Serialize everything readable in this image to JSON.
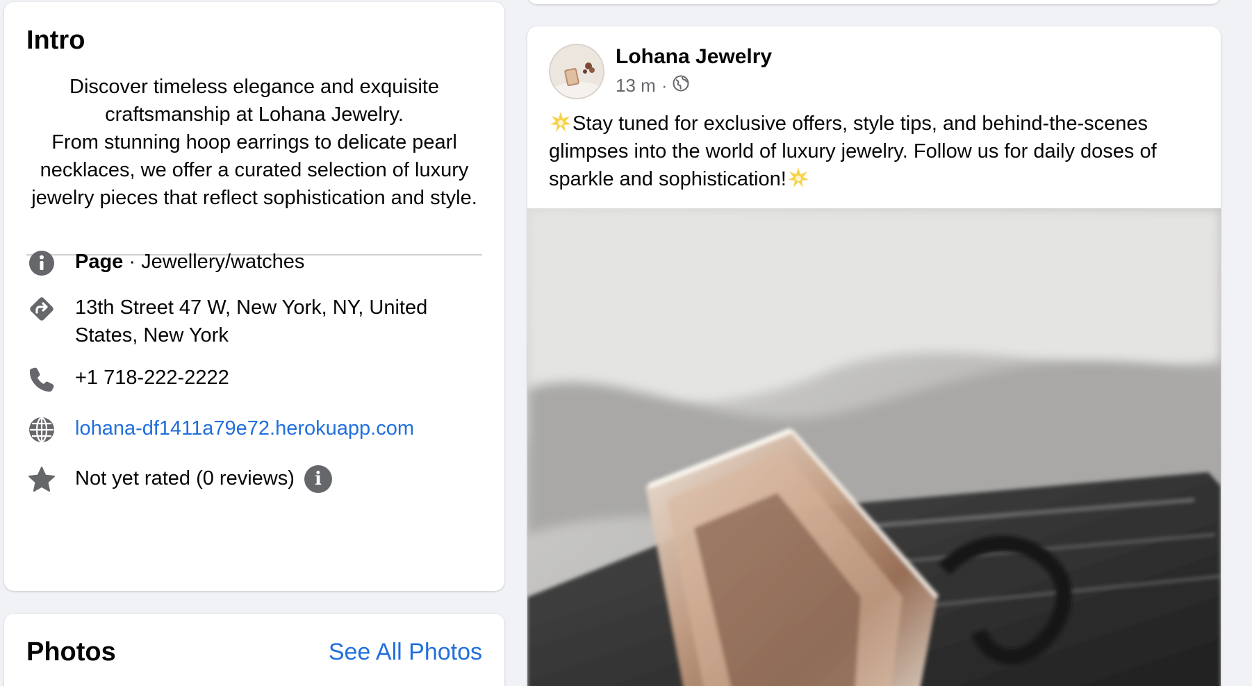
{
  "intro": {
    "title": "Intro",
    "bio": "Discover timeless elegance and exquisite craftsmanship at Lohana Jewelry.\nFrom stunning hoop earrings to delicate pearl necklaces, we offer a curated selection of luxury jewelry pieces that reflect sophistication and style.",
    "page_label": "Page",
    "category": " · Jewellery/watches",
    "address": "13th Street 47 W, New York, NY, United States, New York",
    "phone": "+1 718-222-2222",
    "website": "lohana-df1411a79e72.herokuapp.com",
    "rating": "Not yet rated (0 reviews)",
    "icons": [
      "info-icon",
      "directions-icon",
      "phone-icon",
      "globe-icon",
      "star-icon",
      "info-icon"
    ]
  },
  "photos": {
    "title": "Photos",
    "see_all": "See All Photos"
  },
  "post": {
    "author": "Lohana Jewelry",
    "time": "13 m",
    "separator": "·",
    "audience_icon": "globe-icon",
    "text": "Stay tuned for exclusive offers, style tips, and behind-the-scenes glimpses into the world of luxury jewelry. Follow us for daily doses of sparkle and sophistication!",
    "image_alt": "perfume bottle on dark tray"
  },
  "colors": {
    "page_bg": "#f0f2f5",
    "card_bg": "#ffffff",
    "link": "#216fdb",
    "secondary_text": "#65676b",
    "icon_gray": "#65676b"
  }
}
